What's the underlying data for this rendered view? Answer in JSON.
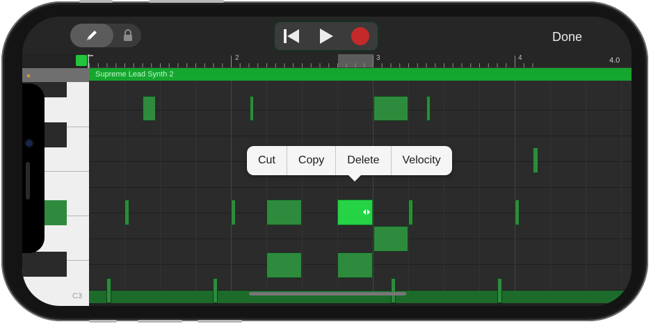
{
  "toolbar": {
    "done_label": "Done",
    "record_color": "#c42a2a"
  },
  "ruler": {
    "bars": [
      "2",
      "3",
      "4"
    ],
    "zoom_label": "4.0"
  },
  "region": {
    "name": "Supreme Lead Synth 2",
    "color": "#15a62f"
  },
  "piano": {
    "octave_label": "C3"
  },
  "context_menu": {
    "items": [
      "Cut",
      "Copy",
      "Delete",
      "Velocity"
    ]
  },
  "icons": [
    "pencil-icon",
    "lock-icon",
    "go-to-beginning-icon",
    "play-icon",
    "record-icon",
    "resize-handle-icon"
  ]
}
